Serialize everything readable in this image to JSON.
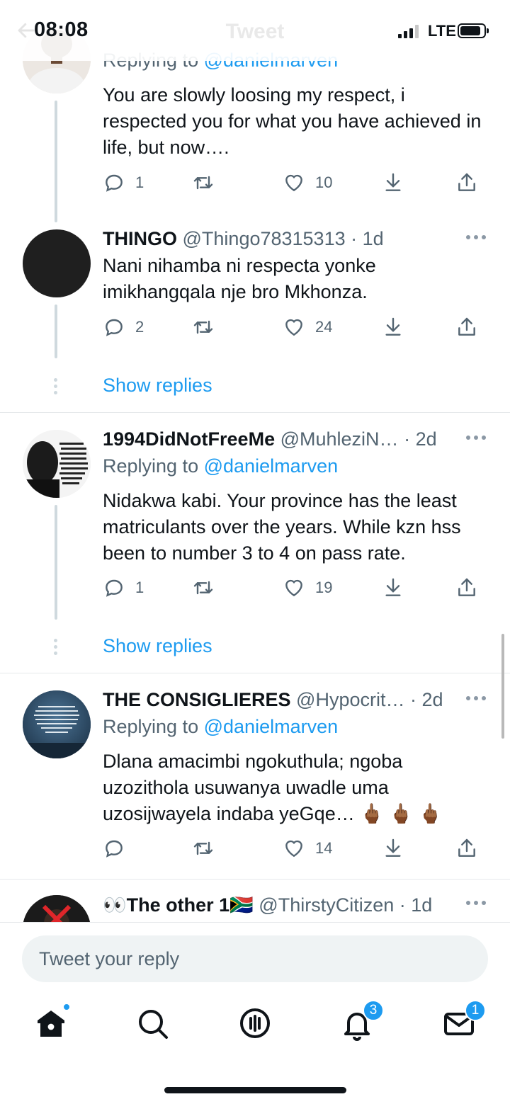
{
  "status_bar": {
    "time": "08:08",
    "network": "LTE"
  },
  "header": {
    "title": "Tweet"
  },
  "tweets": [
    {
      "name": "",
      "handle": "",
      "time": "",
      "replying_label": "Replying to",
      "replying_handle": "@danielmarven",
      "text": "You are slowly loosing my respect, i respected you for what you have achieved in life, but now….",
      "replies": "1",
      "retweets": "",
      "likes": "10"
    },
    {
      "name": "THINGO",
      "handle": "@Thingo78315313",
      "time": "· 1d",
      "text": "Nani nihamba ni respecta yonke imikhangqala nje bro Mkhonza.",
      "replies": "2",
      "retweets": "",
      "likes": "24",
      "show_replies": "Show replies"
    },
    {
      "name": "1994DidNotFreeMe",
      "handle": "@MuhleziN…",
      "time": "· 2d",
      "replying_label": "Replying to",
      "replying_handle": "@danielmarven",
      "text": "Nidakwa kabi. Your province has the least matriculants over the years. While kzn hss been to number 3 to 4 on pass rate.",
      "replies": "1",
      "retweets": "",
      "likes": "19",
      "show_replies": "Show replies",
      "avatar_text": "When we defeat you to find some Negro boot-licking, licking, buck-dancing, bamboozled, half-baked, half-fried, sissified, punkified, pasteurized, homogenized nigger that they can put in front of"
    },
    {
      "name": "THE CONSIGLIERES",
      "handle": "@Hypocrit…",
      "time": "· 2d",
      "replying_label": "Replying to",
      "replying_handle": "@danielmarven",
      "text": "Dlana amacimbi ngokuthula; ngoba uzozithola usuwanya uwadle uma uzosijwayela indaba yeGqe…",
      "emoji": "🖕🏾 🖕🏾 🖕🏾",
      "replies": "",
      "retweets": "",
      "likes": "14",
      "avatar_text": "We are not all in the same boat. We are in the same storm. Some have yachts, some have canoes, and some are drowning. Just be kind and help whoever you can."
    },
    {
      "name_prefix": "👀",
      "name": "The other 1",
      "name_suffix": "🇿🇦",
      "handle": "@ThirstyCitizen",
      "time": "· 1d"
    }
  ],
  "reply_box": {
    "placeholder": "Tweet your reply"
  },
  "tabbar": {
    "notifications_badge": "3",
    "messages_badge": "1"
  },
  "icons": [
    "reply-icon",
    "retweet-icon",
    "like-icon",
    "download-icon",
    "share-icon",
    "home-icon",
    "search-icon",
    "spaces-icon",
    "bell-icon",
    "mail-icon"
  ],
  "colors": {
    "accent": "#1d9bf0",
    "text": "#0f1419",
    "muted": "#536471"
  }
}
